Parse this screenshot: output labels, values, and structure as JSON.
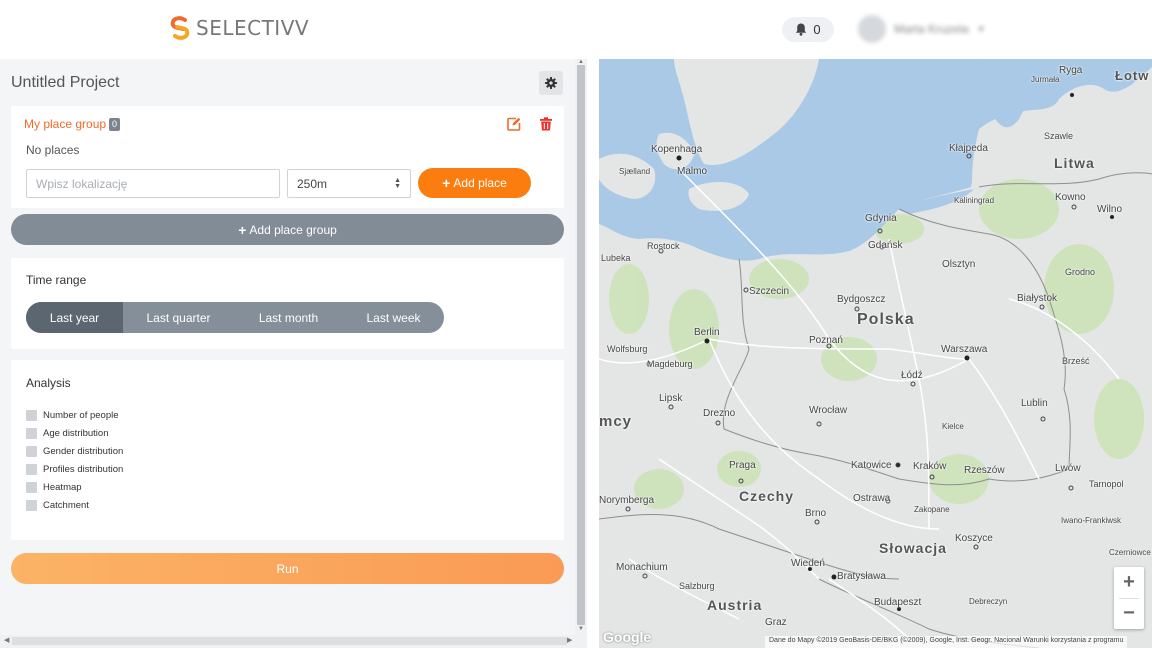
{
  "header": {
    "brand": "SELECTIVV",
    "notifications_count": "0",
    "user_name": "Marta Kruzela"
  },
  "project": {
    "title": "Untitled Project"
  },
  "place_group": {
    "name": "My place group",
    "count": "0",
    "empty_text": "No places",
    "location_placeholder": "Wpisz lokalizację",
    "radius_value": "250m",
    "add_place_label": "Add place"
  },
  "add_group_label": "Add place group",
  "time_range": {
    "title": "Time range",
    "options": [
      "Last year",
      "Last quarter",
      "Last month",
      "Last week"
    ],
    "selected": "Last year"
  },
  "analysis": {
    "title": "Analysis",
    "options": [
      "Number of people",
      "Age distribution",
      "Gender distribution",
      "Profiles distribution",
      "Heatmap",
      "Catchment"
    ]
  },
  "run_label": "Run",
  "map": {
    "countries": [
      "Polska",
      "Litwa",
      "Czechy",
      "Słowacja",
      "Austria",
      "mcy"
    ],
    "cities": [
      "Kopenhaga",
      "Malmo",
      "Gdynia",
      "Gdańsk",
      "Szczecin",
      "Bydgoszcz",
      "Berlin",
      "Poznań",
      "Warszawa",
      "Łódź",
      "Wrocław",
      "Lipsk",
      "Drezno",
      "Katowice",
      "Kraków",
      "Praga",
      "Brno",
      "Ostrawa",
      "Wiedeń",
      "Bratysława",
      "Budapeszt",
      "Lublin",
      "Białystok",
      "Kłajpeda",
      "Kowno",
      "Wilno",
      "Lwów",
      "Rzeszów",
      "Olsztyn",
      "Kaliningrad",
      "Rostock",
      "Lubeka",
      "Magdeburg",
      "Wolfsburg",
      "Norymberga",
      "Monachium",
      "Salzburg",
      "Graz",
      "Koszyce",
      "Ryga",
      "Grodno",
      "Brześć",
      "Kielce",
      "Tarnopol",
      "Zakopane",
      "Debreczyn",
      "Iwano-Frankiwsk",
      "Czerniowce",
      "Szawle",
      "Jurmała",
      "Sjælland",
      "Łotw"
    ],
    "attribution": "Dane do Mapy ©2019 GeoBasis-DE/BKG (©2009), Google, Inst. Geogr. Nacional   Warunki korzystania z programu",
    "google_label": "Google",
    "zoom_in": "+",
    "zoom_out": "−",
    "colors": {
      "water": "#a9c9e6",
      "land": "#e4e6e5",
      "forest": "#c9e2b3",
      "accent": "#fb7d10"
    }
  }
}
